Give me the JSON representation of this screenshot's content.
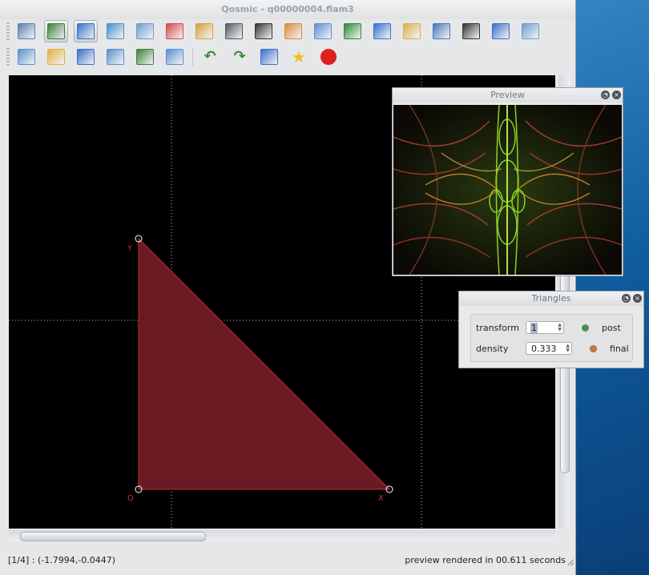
{
  "window": {
    "title": "Qosmic - q00000004.flam3"
  },
  "toolbar1": [
    {
      "name": "monitor-icon",
      "color": "#5a7fb0"
    },
    {
      "name": "image-icon",
      "color": "#3f7f3a",
      "active": true
    },
    {
      "name": "window-icon",
      "color": "#3a6fc9",
      "active": true
    },
    {
      "name": "triangle-icon",
      "color": "#4a90c8"
    },
    {
      "name": "table-icon",
      "color": "#6e9bd0"
    },
    {
      "name": "color-grid-icon",
      "color": "#d54b4b"
    },
    {
      "name": "edit-icon",
      "color": "#d6a13a"
    },
    {
      "name": "camera-icon",
      "color": "#555b61"
    },
    {
      "name": "dial-icon",
      "color": "#333333"
    },
    {
      "name": "palette-icon",
      "color": "#d98b3c"
    },
    {
      "name": "calendar-grid-icon",
      "color": "#5b8fd1"
    },
    {
      "name": "film-icon",
      "color": "#2f8a36"
    },
    {
      "name": "bar-chart-icon",
      "color": "#3b6fd0"
    },
    {
      "name": "folder-search-icon",
      "color": "#d7b04a"
    },
    {
      "name": "hatch-icon",
      "color": "#4a78b5"
    },
    {
      "name": "list-icon",
      "color": "#333333"
    },
    {
      "name": "windows-icon",
      "color": "#3a6fc9"
    },
    {
      "name": "scroll-icon",
      "color": "#6e9bd0"
    }
  ],
  "toolbar2": [
    {
      "name": "new-window-icon",
      "color": "#5b8fd1"
    },
    {
      "name": "open-folder-icon",
      "color": "#e0b23d"
    },
    {
      "name": "save-icon",
      "color": "#3a6fc9"
    },
    {
      "name": "save-as-icon",
      "color": "#5b8fd1"
    },
    {
      "name": "save-image-icon",
      "color": "#3f7f3a"
    },
    {
      "name": "save-all-icon",
      "color": "#5b8fd1"
    },
    {
      "name": "undo-icon",
      "color": "#3a8a3a"
    },
    {
      "name": "redo-icon",
      "color": "#3a8a3a"
    },
    {
      "name": "crop-icon",
      "color": "#3a6fc9"
    },
    {
      "name": "star-icon",
      "color": "#f2c21b"
    },
    {
      "name": "stop-icon",
      "color": "#e02020"
    }
  ],
  "canvas": {
    "vertex_labels": {
      "o": "O",
      "x": "X",
      "y": "Y"
    }
  },
  "status": {
    "left": "[1/4] : (-1.7994,-0.0447)",
    "right": "preview rendered in 00.611 seconds"
  },
  "preview_panel": {
    "title": "Preview"
  },
  "triangles_panel": {
    "title": "Triangles",
    "transform_label": "transform",
    "transform_value": "1",
    "density_label": "density",
    "density_value": "0.333",
    "post_label": "post",
    "final_label": "final",
    "post_color": "#3a9a3a",
    "final_color": "#e07020"
  }
}
